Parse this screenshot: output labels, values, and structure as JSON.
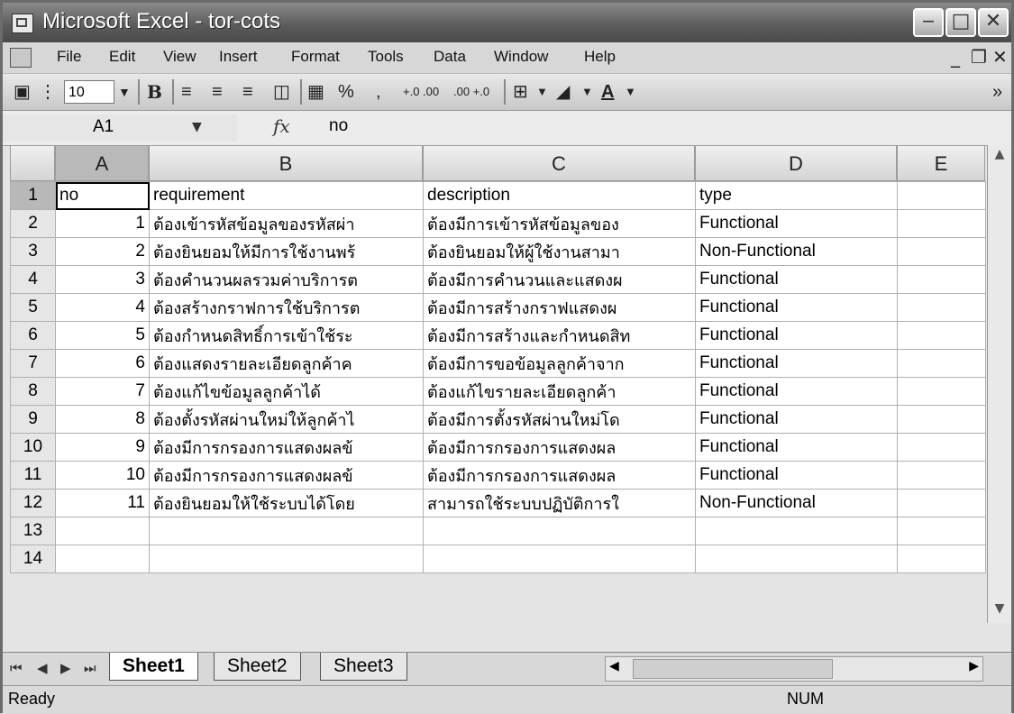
{
  "window": {
    "title": "Microsoft Excel - tor-cots"
  },
  "menu": [
    "File",
    "Edit",
    "View",
    "Insert",
    "Format",
    "Tools",
    "Data",
    "Window",
    "Help"
  ],
  "toolbar": {
    "font_size": "10",
    "bold": "B",
    "percent": "%",
    "comma": ",",
    "inc_decimal": "+.0 .00",
    "dec_decimal": ".00 +.0",
    "font_color": "A"
  },
  "formula_bar": {
    "name_box": "A1",
    "fx": "fx",
    "value": "no"
  },
  "columns": [
    "A",
    "B",
    "C",
    "D",
    "E"
  ],
  "rows": [
    {
      "n": "1",
      "a": "no",
      "b": "requirement",
      "c": "description",
      "d": "type"
    },
    {
      "n": "2",
      "a": "1",
      "b": "ต้องเข้ารหัสข้อมูลของรหัสผ่า",
      "c": "ต้องมีการเข้ารหัสข้อมูลของ",
      "d": "Functional"
    },
    {
      "n": "3",
      "a": "2",
      "b": "ต้องยินยอมให้มีการใช้งานพร้",
      "c": "ต้องยินยอมให้ผู้ใช้งานสามา",
      "d": "Non-Functional"
    },
    {
      "n": "4",
      "a": "3",
      "b": "ต้องคำนวนผลรวมค่าบริการต",
      "c": "ต้องมีการคำนวนและแสดงผ",
      "d": "Functional"
    },
    {
      "n": "5",
      "a": "4",
      "b": "ต้องสร้างกราฟการใช้บริการต",
      "c": "ต้องมีการสร้างกราฟแสดงผ",
      "d": "Functional"
    },
    {
      "n": "6",
      "a": "5",
      "b": "ต้องกำหนดสิทธิ์การเข้าใช้ระ",
      "c": "ต้องมีการสร้างและกำหนดสิท",
      "d": "Functional"
    },
    {
      "n": "7",
      "a": "6",
      "b": "ต้องแสดงรายละเอียดลูกค้าค",
      "c": "ต้องมีการขอข้อมูลลูกค้าจาก",
      "d": "Functional"
    },
    {
      "n": "8",
      "a": "7",
      "b": "ต้องแก้ไขข้อมูลลูกค้าได้",
      "c": "ต้องแก้ไขรายละเอียดลูกค้า",
      "d": "Functional"
    },
    {
      "n": "9",
      "a": "8",
      "b": "ต้องตั้งรหัสผ่านใหม่ให้ลูกค้าไ",
      "c": "ต้องมีการตั้งรหัสผ่านใหม่โด",
      "d": "Functional"
    },
    {
      "n": "10",
      "a": "9",
      "b": "ต้องมีการกรองการแสดงผลข้",
      "c": "ต้องมีการกรองการแสดงผล",
      "d": "Functional"
    },
    {
      "n": "11",
      "a": "10",
      "b": "ต้องมีการกรองการแสดงผลข้",
      "c": "ต้องมีการกรองการแสดงผล",
      "d": "Functional"
    },
    {
      "n": "12",
      "a": "11",
      "b": "ต้องยินยอมให้ใช้ระบบได้โดย",
      "c": "สามารถใช้ระบบปฏิบัติการใ",
      "d": "Non-Functional"
    },
    {
      "n": "13",
      "a": "",
      "b": "",
      "c": "",
      "d": ""
    },
    {
      "n": "14",
      "a": "",
      "b": "",
      "c": "",
      "d": ""
    }
  ],
  "sheets": [
    "Sheet1",
    "Sheet2",
    "Sheet3"
  ],
  "status": {
    "text": "Ready",
    "num": "NUM"
  }
}
